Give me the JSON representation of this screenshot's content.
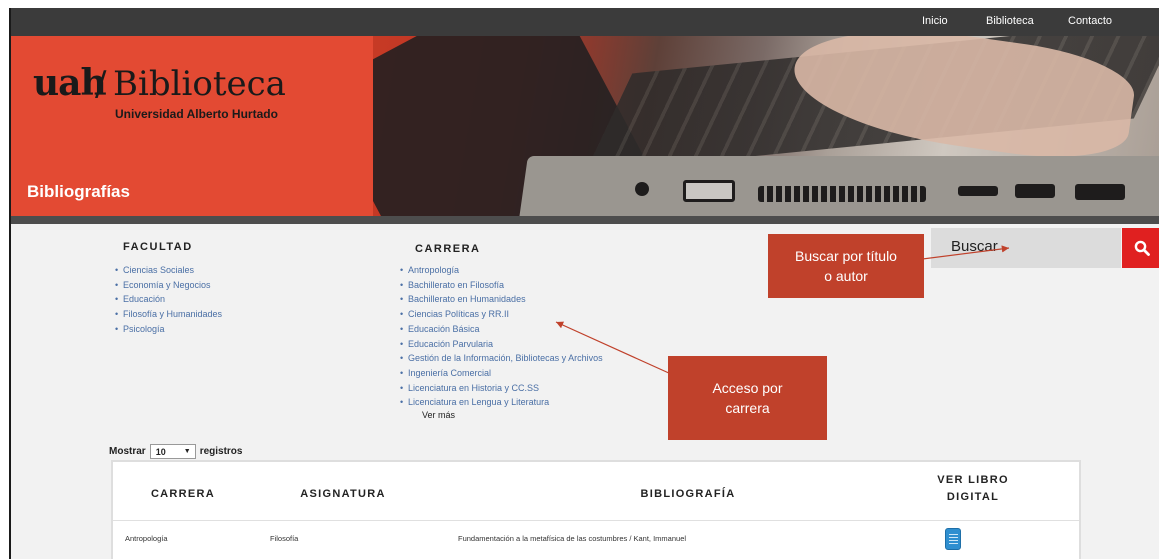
{
  "topnav": {
    "links": [
      "Inicio",
      "Biblioteca",
      "Contacto"
    ]
  },
  "banner": {
    "logo_uah": "uah",
    "logo_slash": "/",
    "logo_biblioteca": "Biblioteca",
    "logo_university": "Universidad Alberto Hurtado",
    "title": "Bibliografías"
  },
  "facultad": {
    "heading": "FACULTAD",
    "items": [
      "Ciencias Sociales",
      "Economía y Negocios",
      "Educación",
      "Filosofía y Humanidades",
      "Psicología"
    ]
  },
  "carrera": {
    "heading": "CARRERA",
    "items": [
      "Antropología",
      "Bachillerato en Filosofía",
      "Bachillerato en Humanidades",
      "Ciencias Políticas y RR.II",
      "Educación Básica",
      "Educación Parvularia",
      "Gestión de la Información, Bibliotecas y Archivos",
      "Ingeniería Comercial",
      "Licenciatura en Historia y CC.SS",
      "Licenciatura en Lengua y Literatura"
    ],
    "ver_mas": "Ver más"
  },
  "search": {
    "placeholder": "Buscar",
    "icon": "search-icon"
  },
  "callouts": {
    "buscar": "Buscar por título o autor",
    "acceso": "Acceso por carrera"
  },
  "table_controls": {
    "mostrar": "Mostrar",
    "page_size": "10",
    "registros": "registros"
  },
  "table": {
    "headers": [
      "CARRERA",
      "ASIGNATURA",
      "BIBLIOGRAFÍA",
      "VER LIBRO DIGITAL"
    ],
    "rows": [
      {
        "carrera": "Antropología",
        "asignatura": "Filosofía",
        "bibliografia": "Fundamentación a la metafísica de las costumbres / Kant, Immanuel",
        "icon": "book-icon"
      }
    ]
  },
  "colors": {
    "brand_red": "#e34a33",
    "callout_red": "#c0412b",
    "search_red": "#e02020",
    "link_blue": "#4a6fa5"
  }
}
